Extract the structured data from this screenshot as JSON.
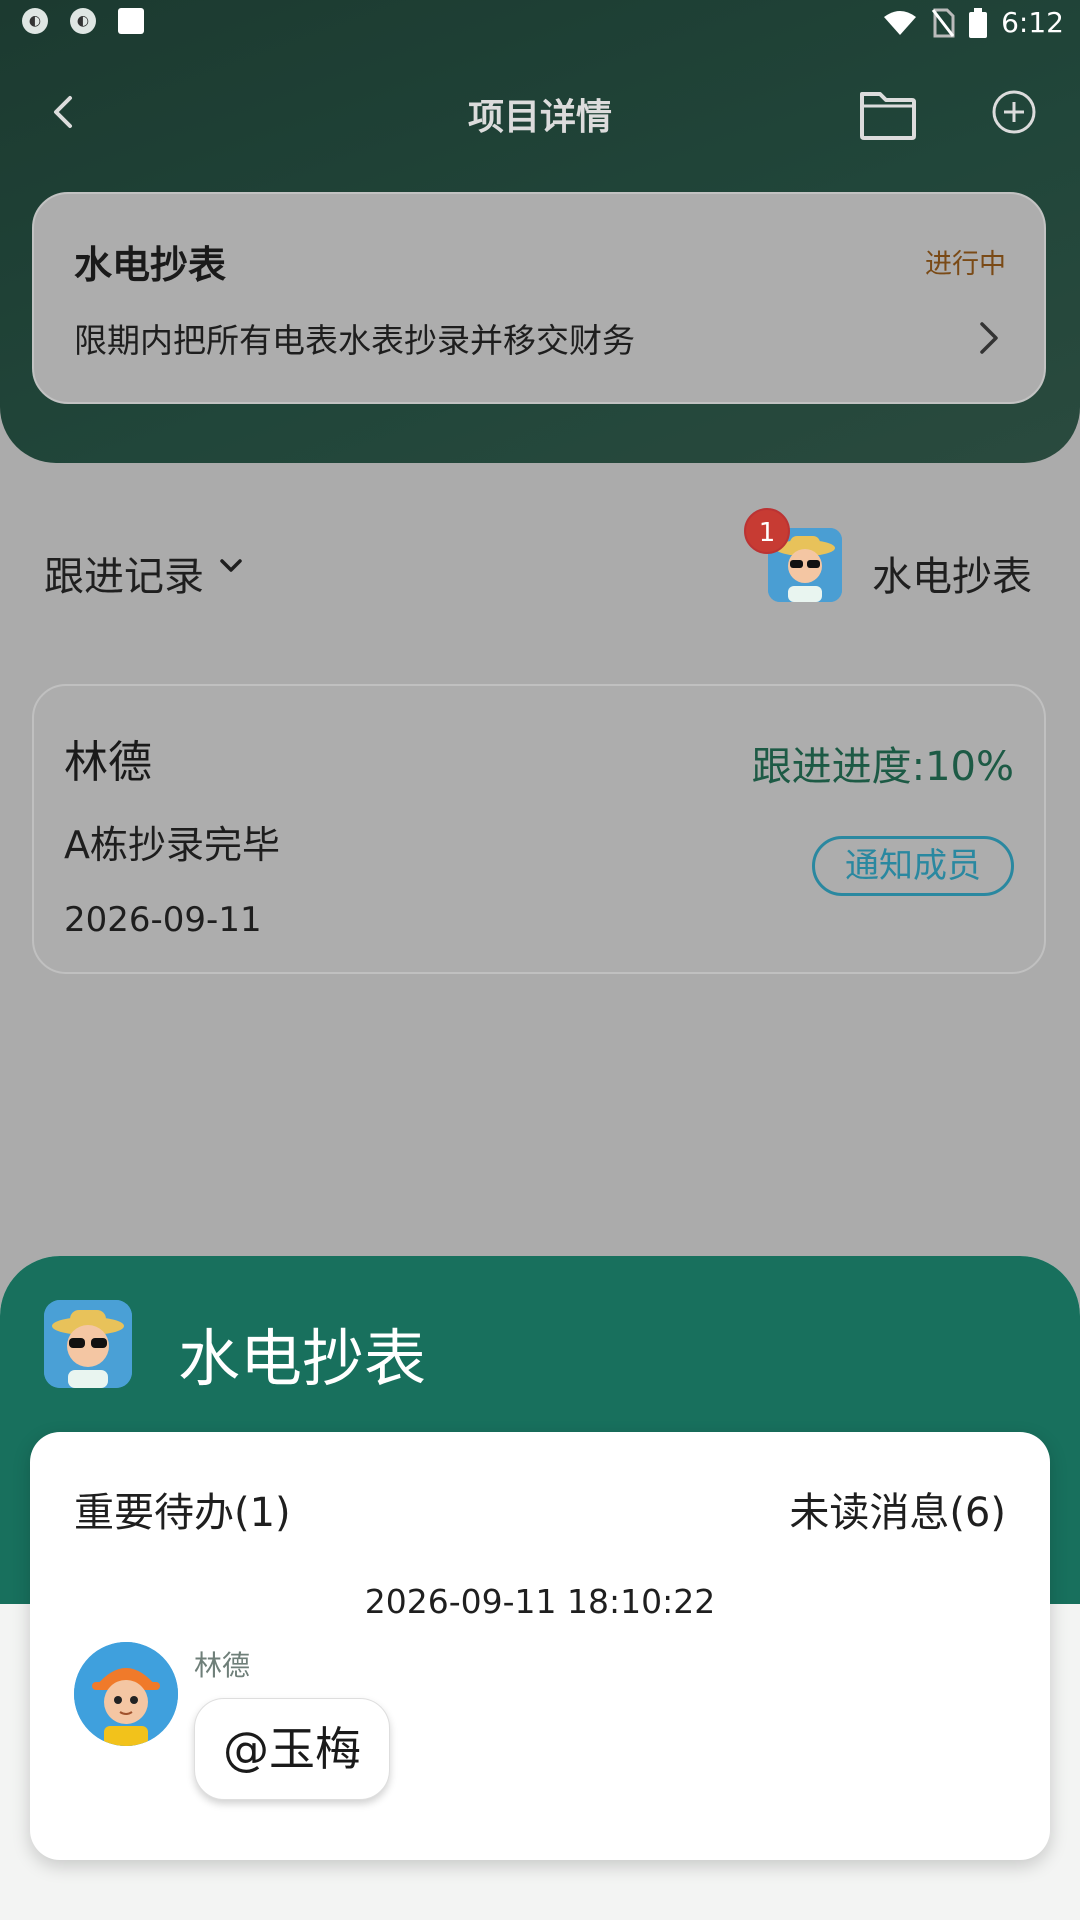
{
  "status_bar": {
    "time": "6:12",
    "icons": [
      "app-icon",
      "app-icon",
      "image-icon",
      "wifi-icon",
      "no-sim-icon",
      "battery-icon"
    ]
  },
  "nav": {
    "title": "项目详情",
    "back_icon": "chevron-left-icon",
    "folder_icon": "folder-icon",
    "add_icon": "plus-circle-icon"
  },
  "project": {
    "title": "水电抄表",
    "status": "进行中",
    "description": "限期内把所有电表水表抄录并移交财务"
  },
  "follow": {
    "label": "跟进记录",
    "badge_count": "1",
    "project_name": "水电抄表"
  },
  "record": {
    "name": "林德",
    "progress": "跟进进度:10%",
    "text": "A栋抄录完毕",
    "date": "2026-09-11",
    "notify_label": "通知成员"
  },
  "sheet": {
    "title": "水电抄表",
    "todo_label": "重要待办(1)",
    "unread_label": "未读消息(6)",
    "message_time": "2026-09-11 18:10:22",
    "sender": "林德",
    "message": "@玉梅"
  },
  "colors": {
    "header": "#1f4034",
    "sheet_green": "#18705d",
    "progress_text": "#1d5a45",
    "notify_border": "#2a88a0",
    "badge": "#c73b33"
  }
}
